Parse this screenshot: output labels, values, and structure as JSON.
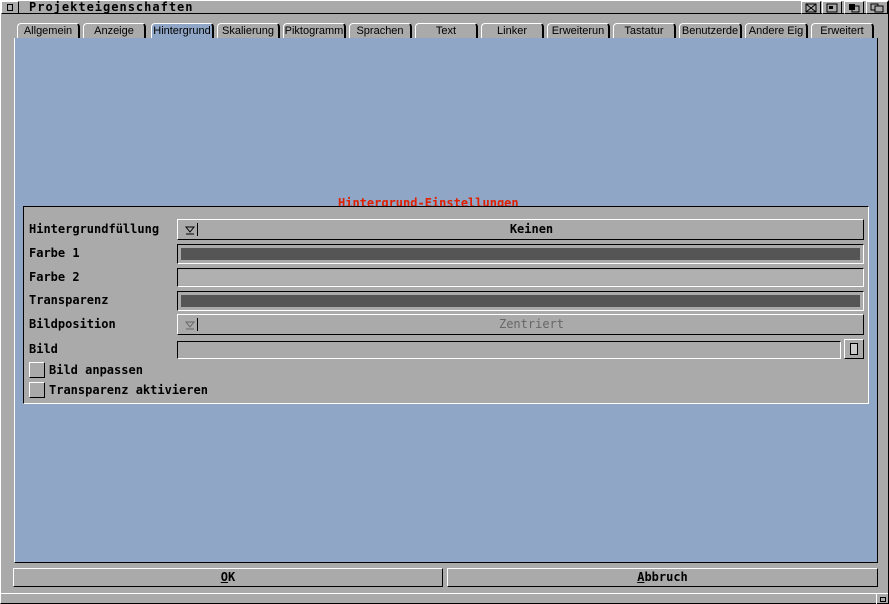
{
  "window": {
    "title": "Projekteigenschaften"
  },
  "tabs": [
    {
      "label": "Allgemein",
      "active": false
    },
    {
      "label": "Anzeige",
      "active": false
    },
    {
      "label": "Hintergrund",
      "active": true
    },
    {
      "label": "Skalierung",
      "active": false
    },
    {
      "label": "Piktogramm",
      "active": false
    },
    {
      "label": "Sprachen",
      "active": false
    },
    {
      "label": "Text",
      "active": false
    },
    {
      "label": "Linker",
      "active": false
    },
    {
      "label": "Erweiterun",
      "active": false
    },
    {
      "label": "Tastatur",
      "active": false
    },
    {
      "label": "Benutzerde",
      "active": false
    },
    {
      "label": "Andere Eig",
      "active": false
    },
    {
      "label": "Erweitert",
      "active": false
    }
  ],
  "group": {
    "title": "Hintergrund-Einstellungen",
    "fill": {
      "label": "Hintergrundfüllung",
      "value": "Keinen"
    },
    "color1": {
      "label": "Farbe 1",
      "color": "#555555"
    },
    "color2": {
      "label": "Farbe 2",
      "color": "#b0b0b0"
    },
    "transparency": {
      "label": "Transparenz",
      "color": "#555555"
    },
    "position": {
      "label": "Bildposition",
      "value": "Zentriert"
    },
    "image": {
      "label": "Bild",
      "value": ""
    },
    "fit_image": {
      "label": "Bild anpassen",
      "checked": false
    },
    "enable_transparency": {
      "label": "Transparenz aktivieren",
      "checked": false
    }
  },
  "buttons": {
    "ok": {
      "underline": "O",
      "rest": "K"
    },
    "cancel": {
      "underline": "A",
      "rest": "bbruch"
    }
  },
  "colors": {
    "panel": "#8fa6c6",
    "window": "#aaaaaa",
    "group_title": "#e02000"
  }
}
